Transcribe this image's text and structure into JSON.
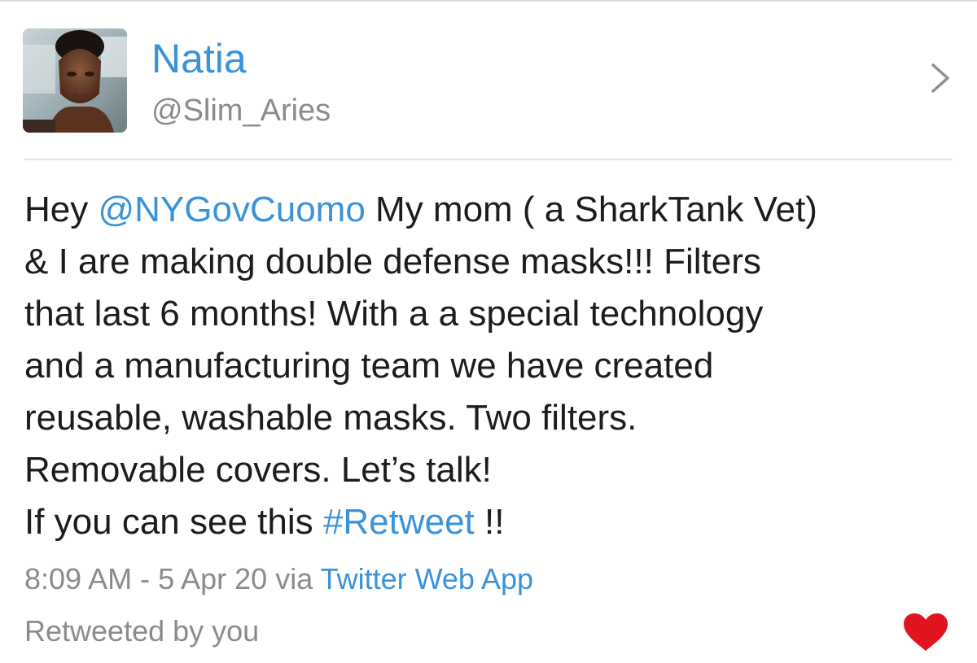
{
  "user": {
    "display_name": "Natia",
    "handle": "@Slim_Aries"
  },
  "tweet": {
    "lines": [
      [
        {
          "text": "Hey ",
          "link": false
        },
        {
          "text": "@NYGovCuomo",
          "link": true
        },
        {
          "text": " My mom ( a SharkTank Vet)",
          "link": false
        }
      ],
      [
        {
          "text": "& I are making double defense masks!!! Filters",
          "link": false
        }
      ],
      [
        {
          "text": "that last 6 months! With a a special technology",
          "link": false
        }
      ],
      [
        {
          "text": "and a manufacturing team we have created",
          "link": false
        }
      ],
      [
        {
          "text": "reusable, washable masks. Two filters.",
          "link": false
        }
      ],
      [
        {
          "text": "Removable covers. Let’s talk!",
          "link": false
        }
      ],
      [
        {
          "text": "If you can see this ",
          "link": false
        },
        {
          "text": "#Retweet",
          "link": true
        },
        {
          "text": " !!",
          "link": false
        }
      ]
    ],
    "timestamp": "8:09 AM - 5 Apr 20",
    "via_prefix": " via ",
    "source": "Twitter Web App"
  },
  "status": {
    "retweeted_label": "Retweeted by you",
    "liked": true
  },
  "icons": {
    "chevron": "chevron-right-icon",
    "heart": "heart-icon"
  },
  "colors": {
    "link": "#3a93d8",
    "text": "#1c1c1e",
    "muted": "#8a8a8f",
    "heart": "#e0141e",
    "divider": "#e2e2e6"
  }
}
